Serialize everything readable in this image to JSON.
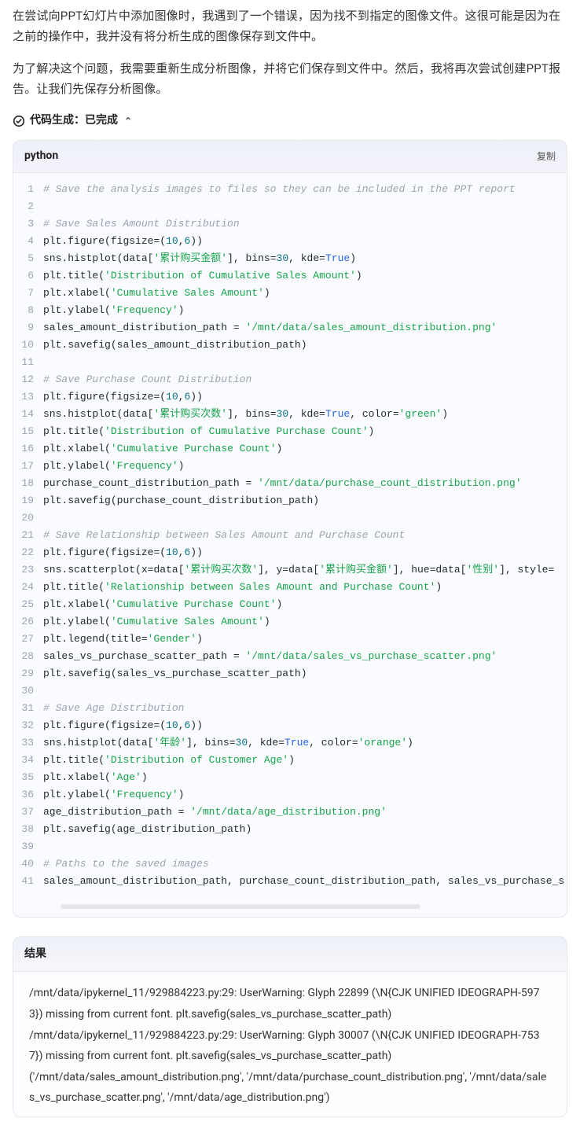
{
  "explanation": {
    "p1": "在尝试向PPT幻灯片中添加图像时，我遇到了一个错误，因为找不到指定的图像文件。这很可能是因为在之前的操作中，我并没有将分析生成的图像保存到文件中。",
    "p2": "为了解决这个问题，我需要重新生成分析图像，并将它们保存到文件中。然后，我将再次尝试创建PPT报告。让我们先保存分析图像。"
  },
  "codegen": {
    "label_prefix": "代码生成：",
    "status": "已完成"
  },
  "code_block": {
    "language": "python",
    "copy_label": "复制",
    "lines": [
      [
        {
          "t": "comment",
          "v": "# Save the analysis images to files so they can be included in the PPT report"
        }
      ],
      [],
      [
        {
          "t": "comment",
          "v": "# Save Sales Amount Distribution"
        }
      ],
      [
        {
          "t": "ident",
          "v": "plt"
        },
        {
          "t": "punc",
          "v": "."
        },
        {
          "t": "func",
          "v": "figure"
        },
        {
          "t": "punc",
          "v": "("
        },
        {
          "t": "attr",
          "v": "figsize"
        },
        {
          "t": "punc",
          "v": "=("
        },
        {
          "t": "num",
          "v": "10"
        },
        {
          "t": "punc",
          "v": ","
        },
        {
          "t": "num",
          "v": "6"
        },
        {
          "t": "punc",
          "v": "))"
        }
      ],
      [
        {
          "t": "ident",
          "v": "sns"
        },
        {
          "t": "punc",
          "v": "."
        },
        {
          "t": "func",
          "v": "histplot"
        },
        {
          "t": "punc",
          "v": "("
        },
        {
          "t": "ident",
          "v": "data"
        },
        {
          "t": "punc",
          "v": "["
        },
        {
          "t": "str",
          "v": "'累计购买金额'"
        },
        {
          "t": "punc",
          "v": "], "
        },
        {
          "t": "attr",
          "v": "bins"
        },
        {
          "t": "punc",
          "v": "="
        },
        {
          "t": "num",
          "v": "30"
        },
        {
          "t": "punc",
          "v": ", "
        },
        {
          "t": "attr",
          "v": "kde"
        },
        {
          "t": "punc",
          "v": "="
        },
        {
          "t": "kw",
          "v": "True"
        },
        {
          "t": "punc",
          "v": ")"
        }
      ],
      [
        {
          "t": "ident",
          "v": "plt"
        },
        {
          "t": "punc",
          "v": "."
        },
        {
          "t": "func",
          "v": "title"
        },
        {
          "t": "punc",
          "v": "("
        },
        {
          "t": "str",
          "v": "'Distribution of Cumulative Sales Amount'"
        },
        {
          "t": "punc",
          "v": ")"
        }
      ],
      [
        {
          "t": "ident",
          "v": "plt"
        },
        {
          "t": "punc",
          "v": "."
        },
        {
          "t": "func",
          "v": "xlabel"
        },
        {
          "t": "punc",
          "v": "("
        },
        {
          "t": "str",
          "v": "'Cumulative Sales Amount'"
        },
        {
          "t": "punc",
          "v": ")"
        }
      ],
      [
        {
          "t": "ident",
          "v": "plt"
        },
        {
          "t": "punc",
          "v": "."
        },
        {
          "t": "func",
          "v": "ylabel"
        },
        {
          "t": "punc",
          "v": "("
        },
        {
          "t": "str",
          "v": "'Frequency'"
        },
        {
          "t": "punc",
          "v": ")"
        }
      ],
      [
        {
          "t": "ident",
          "v": "sales_amount_distribution_path"
        },
        {
          "t": "punc",
          "v": " = "
        },
        {
          "t": "str",
          "v": "'/mnt/data/sales_amount_distribution.png'"
        }
      ],
      [
        {
          "t": "ident",
          "v": "plt"
        },
        {
          "t": "punc",
          "v": "."
        },
        {
          "t": "func",
          "v": "savefig"
        },
        {
          "t": "punc",
          "v": "("
        },
        {
          "t": "ident",
          "v": "sales_amount_distribution_path"
        },
        {
          "t": "punc",
          "v": ")"
        }
      ],
      [],
      [
        {
          "t": "comment",
          "v": "# Save Purchase Count Distribution"
        }
      ],
      [
        {
          "t": "ident",
          "v": "plt"
        },
        {
          "t": "punc",
          "v": "."
        },
        {
          "t": "func",
          "v": "figure"
        },
        {
          "t": "punc",
          "v": "("
        },
        {
          "t": "attr",
          "v": "figsize"
        },
        {
          "t": "punc",
          "v": "=("
        },
        {
          "t": "num",
          "v": "10"
        },
        {
          "t": "punc",
          "v": ","
        },
        {
          "t": "num",
          "v": "6"
        },
        {
          "t": "punc",
          "v": "))"
        }
      ],
      [
        {
          "t": "ident",
          "v": "sns"
        },
        {
          "t": "punc",
          "v": "."
        },
        {
          "t": "func",
          "v": "histplot"
        },
        {
          "t": "punc",
          "v": "("
        },
        {
          "t": "ident",
          "v": "data"
        },
        {
          "t": "punc",
          "v": "["
        },
        {
          "t": "str",
          "v": "'累计购买次数'"
        },
        {
          "t": "punc",
          "v": "], "
        },
        {
          "t": "attr",
          "v": "bins"
        },
        {
          "t": "punc",
          "v": "="
        },
        {
          "t": "num",
          "v": "30"
        },
        {
          "t": "punc",
          "v": ", "
        },
        {
          "t": "attr",
          "v": "kde"
        },
        {
          "t": "punc",
          "v": "="
        },
        {
          "t": "kw",
          "v": "True"
        },
        {
          "t": "punc",
          "v": ", "
        },
        {
          "t": "attr",
          "v": "color"
        },
        {
          "t": "punc",
          "v": "="
        },
        {
          "t": "str",
          "v": "'green'"
        },
        {
          "t": "punc",
          "v": ")"
        }
      ],
      [
        {
          "t": "ident",
          "v": "plt"
        },
        {
          "t": "punc",
          "v": "."
        },
        {
          "t": "func",
          "v": "title"
        },
        {
          "t": "punc",
          "v": "("
        },
        {
          "t": "str",
          "v": "'Distribution of Cumulative Purchase Count'"
        },
        {
          "t": "punc",
          "v": ")"
        }
      ],
      [
        {
          "t": "ident",
          "v": "plt"
        },
        {
          "t": "punc",
          "v": "."
        },
        {
          "t": "func",
          "v": "xlabel"
        },
        {
          "t": "punc",
          "v": "("
        },
        {
          "t": "str",
          "v": "'Cumulative Purchase Count'"
        },
        {
          "t": "punc",
          "v": ")"
        }
      ],
      [
        {
          "t": "ident",
          "v": "plt"
        },
        {
          "t": "punc",
          "v": "."
        },
        {
          "t": "func",
          "v": "ylabel"
        },
        {
          "t": "punc",
          "v": "("
        },
        {
          "t": "str",
          "v": "'Frequency'"
        },
        {
          "t": "punc",
          "v": ")"
        }
      ],
      [
        {
          "t": "ident",
          "v": "purchase_count_distribution_path"
        },
        {
          "t": "punc",
          "v": " = "
        },
        {
          "t": "str",
          "v": "'/mnt/data/purchase_count_distribution.png'"
        }
      ],
      [
        {
          "t": "ident",
          "v": "plt"
        },
        {
          "t": "punc",
          "v": "."
        },
        {
          "t": "func",
          "v": "savefig"
        },
        {
          "t": "punc",
          "v": "("
        },
        {
          "t": "ident",
          "v": "purchase_count_distribution_path"
        },
        {
          "t": "punc",
          "v": ")"
        }
      ],
      [],
      [
        {
          "t": "comment",
          "v": "# Save Relationship between Sales Amount and Purchase Count"
        }
      ],
      [
        {
          "t": "ident",
          "v": "plt"
        },
        {
          "t": "punc",
          "v": "."
        },
        {
          "t": "func",
          "v": "figure"
        },
        {
          "t": "punc",
          "v": "("
        },
        {
          "t": "attr",
          "v": "figsize"
        },
        {
          "t": "punc",
          "v": "=("
        },
        {
          "t": "num",
          "v": "10"
        },
        {
          "t": "punc",
          "v": ","
        },
        {
          "t": "num",
          "v": "6"
        },
        {
          "t": "punc",
          "v": "))"
        }
      ],
      [
        {
          "t": "ident",
          "v": "sns"
        },
        {
          "t": "punc",
          "v": "."
        },
        {
          "t": "func",
          "v": "scatterplot"
        },
        {
          "t": "punc",
          "v": "("
        },
        {
          "t": "attr",
          "v": "x"
        },
        {
          "t": "punc",
          "v": "="
        },
        {
          "t": "ident",
          "v": "data"
        },
        {
          "t": "punc",
          "v": "["
        },
        {
          "t": "str",
          "v": "'累计购买次数'"
        },
        {
          "t": "punc",
          "v": "], "
        },
        {
          "t": "attr",
          "v": "y"
        },
        {
          "t": "punc",
          "v": "="
        },
        {
          "t": "ident",
          "v": "data"
        },
        {
          "t": "punc",
          "v": "["
        },
        {
          "t": "str",
          "v": "'累计购买金额'"
        },
        {
          "t": "punc",
          "v": "], "
        },
        {
          "t": "attr",
          "v": "hue"
        },
        {
          "t": "punc",
          "v": "="
        },
        {
          "t": "ident",
          "v": "data"
        },
        {
          "t": "punc",
          "v": "["
        },
        {
          "t": "str",
          "v": "'性别'"
        },
        {
          "t": "punc",
          "v": "], "
        },
        {
          "t": "attr",
          "v": "style"
        },
        {
          "t": "punc",
          "v": "="
        }
      ],
      [
        {
          "t": "ident",
          "v": "plt"
        },
        {
          "t": "punc",
          "v": "."
        },
        {
          "t": "func",
          "v": "title"
        },
        {
          "t": "punc",
          "v": "("
        },
        {
          "t": "str",
          "v": "'Relationship between Sales Amount and Purchase Count'"
        },
        {
          "t": "punc",
          "v": ")"
        }
      ],
      [
        {
          "t": "ident",
          "v": "plt"
        },
        {
          "t": "punc",
          "v": "."
        },
        {
          "t": "func",
          "v": "xlabel"
        },
        {
          "t": "punc",
          "v": "("
        },
        {
          "t": "str",
          "v": "'Cumulative Purchase Count'"
        },
        {
          "t": "punc",
          "v": ")"
        }
      ],
      [
        {
          "t": "ident",
          "v": "plt"
        },
        {
          "t": "punc",
          "v": "."
        },
        {
          "t": "func",
          "v": "ylabel"
        },
        {
          "t": "punc",
          "v": "("
        },
        {
          "t": "str",
          "v": "'Cumulative Sales Amount'"
        },
        {
          "t": "punc",
          "v": ")"
        }
      ],
      [
        {
          "t": "ident",
          "v": "plt"
        },
        {
          "t": "punc",
          "v": "."
        },
        {
          "t": "func",
          "v": "legend"
        },
        {
          "t": "punc",
          "v": "("
        },
        {
          "t": "attr",
          "v": "title"
        },
        {
          "t": "punc",
          "v": "="
        },
        {
          "t": "str",
          "v": "'Gender'"
        },
        {
          "t": "punc",
          "v": ")"
        }
      ],
      [
        {
          "t": "ident",
          "v": "sales_vs_purchase_scatter_path"
        },
        {
          "t": "punc",
          "v": " = "
        },
        {
          "t": "str",
          "v": "'/mnt/data/sales_vs_purchase_scatter.png'"
        }
      ],
      [
        {
          "t": "ident",
          "v": "plt"
        },
        {
          "t": "punc",
          "v": "."
        },
        {
          "t": "func",
          "v": "savefig"
        },
        {
          "t": "punc",
          "v": "("
        },
        {
          "t": "ident",
          "v": "sales_vs_purchase_scatter_path"
        },
        {
          "t": "punc",
          "v": ")"
        }
      ],
      [],
      [
        {
          "t": "comment",
          "v": "# Save Age Distribution"
        }
      ],
      [
        {
          "t": "ident",
          "v": "plt"
        },
        {
          "t": "punc",
          "v": "."
        },
        {
          "t": "func",
          "v": "figure"
        },
        {
          "t": "punc",
          "v": "("
        },
        {
          "t": "attr",
          "v": "figsize"
        },
        {
          "t": "punc",
          "v": "=("
        },
        {
          "t": "num",
          "v": "10"
        },
        {
          "t": "punc",
          "v": ","
        },
        {
          "t": "num",
          "v": "6"
        },
        {
          "t": "punc",
          "v": "))"
        }
      ],
      [
        {
          "t": "ident",
          "v": "sns"
        },
        {
          "t": "punc",
          "v": "."
        },
        {
          "t": "func",
          "v": "histplot"
        },
        {
          "t": "punc",
          "v": "("
        },
        {
          "t": "ident",
          "v": "data"
        },
        {
          "t": "punc",
          "v": "["
        },
        {
          "t": "str",
          "v": "'年龄'"
        },
        {
          "t": "punc",
          "v": "], "
        },
        {
          "t": "attr",
          "v": "bins"
        },
        {
          "t": "punc",
          "v": "="
        },
        {
          "t": "num",
          "v": "30"
        },
        {
          "t": "punc",
          "v": ", "
        },
        {
          "t": "attr",
          "v": "kde"
        },
        {
          "t": "punc",
          "v": "="
        },
        {
          "t": "kw",
          "v": "True"
        },
        {
          "t": "punc",
          "v": ", "
        },
        {
          "t": "attr",
          "v": "color"
        },
        {
          "t": "punc",
          "v": "="
        },
        {
          "t": "str",
          "v": "'orange'"
        },
        {
          "t": "punc",
          "v": ")"
        }
      ],
      [
        {
          "t": "ident",
          "v": "plt"
        },
        {
          "t": "punc",
          "v": "."
        },
        {
          "t": "func",
          "v": "title"
        },
        {
          "t": "punc",
          "v": "("
        },
        {
          "t": "str",
          "v": "'Distribution of Customer Age'"
        },
        {
          "t": "punc",
          "v": ")"
        }
      ],
      [
        {
          "t": "ident",
          "v": "plt"
        },
        {
          "t": "punc",
          "v": "."
        },
        {
          "t": "func",
          "v": "xlabel"
        },
        {
          "t": "punc",
          "v": "("
        },
        {
          "t": "str",
          "v": "'Age'"
        },
        {
          "t": "punc",
          "v": ")"
        }
      ],
      [
        {
          "t": "ident",
          "v": "plt"
        },
        {
          "t": "punc",
          "v": "."
        },
        {
          "t": "func",
          "v": "ylabel"
        },
        {
          "t": "punc",
          "v": "("
        },
        {
          "t": "str",
          "v": "'Frequency'"
        },
        {
          "t": "punc",
          "v": ")"
        }
      ],
      [
        {
          "t": "ident",
          "v": "age_distribution_path"
        },
        {
          "t": "punc",
          "v": " = "
        },
        {
          "t": "str",
          "v": "'/mnt/data/age_distribution.png'"
        }
      ],
      [
        {
          "t": "ident",
          "v": "plt"
        },
        {
          "t": "punc",
          "v": "."
        },
        {
          "t": "func",
          "v": "savefig"
        },
        {
          "t": "punc",
          "v": "("
        },
        {
          "t": "ident",
          "v": "age_distribution_path"
        },
        {
          "t": "punc",
          "v": ")"
        }
      ],
      [],
      [
        {
          "t": "comment",
          "v": "# Paths to the saved images"
        }
      ],
      [
        {
          "t": "ident",
          "v": "sales_amount_distribution_path"
        },
        {
          "t": "punc",
          "v": ", "
        },
        {
          "t": "ident",
          "v": "purchase_count_distribution_path"
        },
        {
          "t": "punc",
          "v": ", "
        },
        {
          "t": "ident",
          "v": "sales_vs_purchase_s"
        }
      ]
    ]
  },
  "result": {
    "header": "结果",
    "lines": [
      "/mnt/data/ipykernel_11/929884223.py:29: UserWarning: Glyph 22899 (\\N{CJK UNIFIED IDEOGRAPH-5973}) missing from current font. plt.savefig(sales_vs_purchase_scatter_path)",
      "/mnt/data/ipykernel_11/929884223.py:29: UserWarning: Glyph 30007 (\\N{CJK UNIFIED IDEOGRAPH-7537}) missing from current font. plt.savefig(sales_vs_purchase_scatter_path)",
      "('/mnt/data/sales_amount_distribution.png', '/mnt/data/purchase_count_distribution.png', '/mnt/data/sales_vs_purchase_scatter.png', '/mnt/data/age_distribution.png')"
    ]
  }
}
